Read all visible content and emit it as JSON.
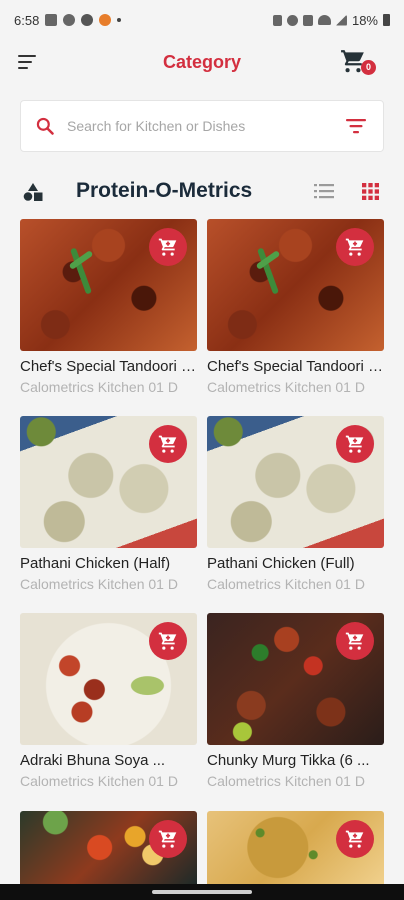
{
  "status_bar": {
    "time": "6:58",
    "battery": "18%"
  },
  "header": {
    "title": "Category",
    "cart_count": "0"
  },
  "search": {
    "placeholder": "Search for Kitchen or Dishes"
  },
  "section": {
    "title": "Protein-O-Metrics"
  },
  "items": [
    {
      "name": "Chef's Special Tandoori Chicken",
      "kitchen": "Calometrics Kitchen 01 D",
      "image": "tandoori"
    },
    {
      "name": "Chef's Special Tandoori Chicken",
      "kitchen": "Calometrics Kitchen 01 D",
      "image": "tandoori"
    },
    {
      "name": "Pathani Chicken (Half)",
      "kitchen": "Calometrics Kitchen 01 D",
      "image": "pathani"
    },
    {
      "name": "Pathani Chicken (Full)",
      "kitchen": "Calometrics Kitchen 01 D",
      "image": "pathani"
    },
    {
      "name": "Adraki Bhuna Soya ...",
      "kitchen": "Calometrics Kitchen 01 D",
      "image": "adraki"
    },
    {
      "name": "Chunky Murg Tikka (6 ...",
      "kitchen": "Calometrics Kitchen 01 D",
      "image": "chunky"
    },
    {
      "name": "",
      "kitchen": "",
      "image": "skewer"
    },
    {
      "name": "",
      "kitchen": "",
      "image": "paratha"
    }
  ],
  "colors": {
    "accent": "#d32f3f",
    "title_text": "#1b2b3a",
    "muted_text": "#b3b3b3"
  },
  "icons": {
    "menu": "menu-icon",
    "cart": "cart-icon",
    "search": "search-icon",
    "filter": "filter-icon",
    "category": "category-shapes-icon",
    "list_view": "list-view-icon",
    "grid_view": "grid-view-icon",
    "add_to_cart": "add-to-cart-icon"
  }
}
